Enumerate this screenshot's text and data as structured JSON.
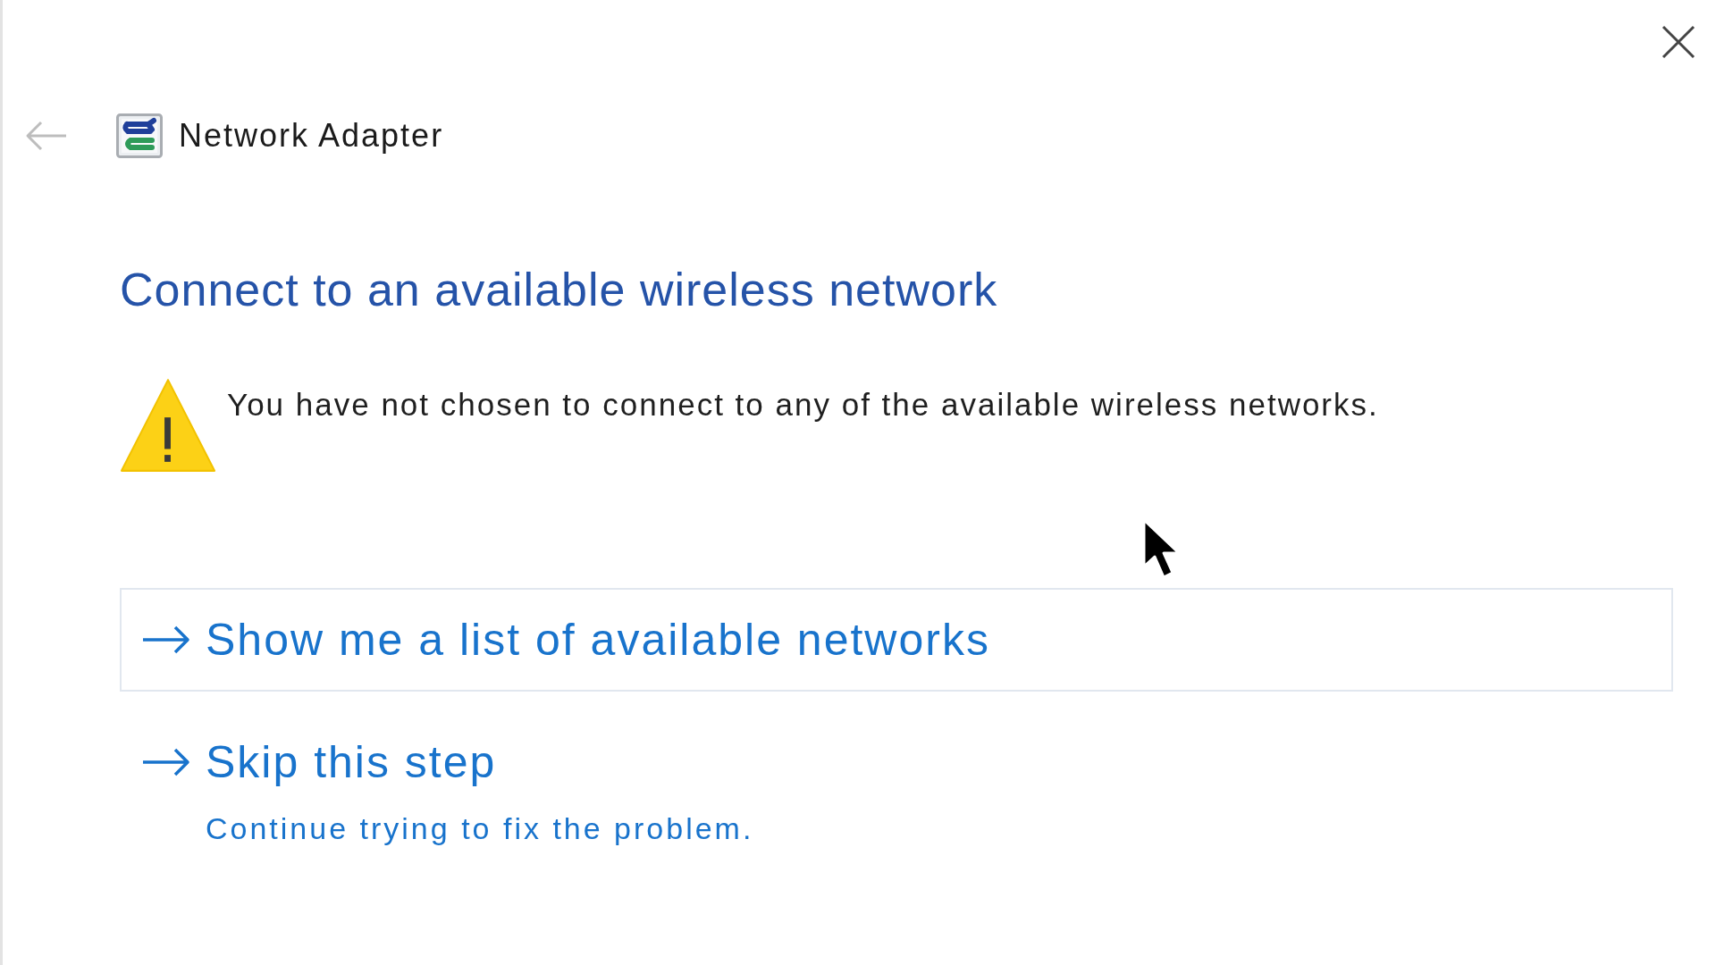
{
  "back_button": {
    "disabled": true
  },
  "header": {
    "title": "Network Adapter"
  },
  "heading": "Connect to an available wireless network",
  "message": {
    "kind": "warning",
    "text": "You have not chosen to connect to any of the available wireless networks."
  },
  "options": [
    {
      "title": "Show me a list of available networks",
      "focused": true
    },
    {
      "title": "Skip this step",
      "description": "Continue trying to fix the problem.",
      "focused": false
    }
  ]
}
